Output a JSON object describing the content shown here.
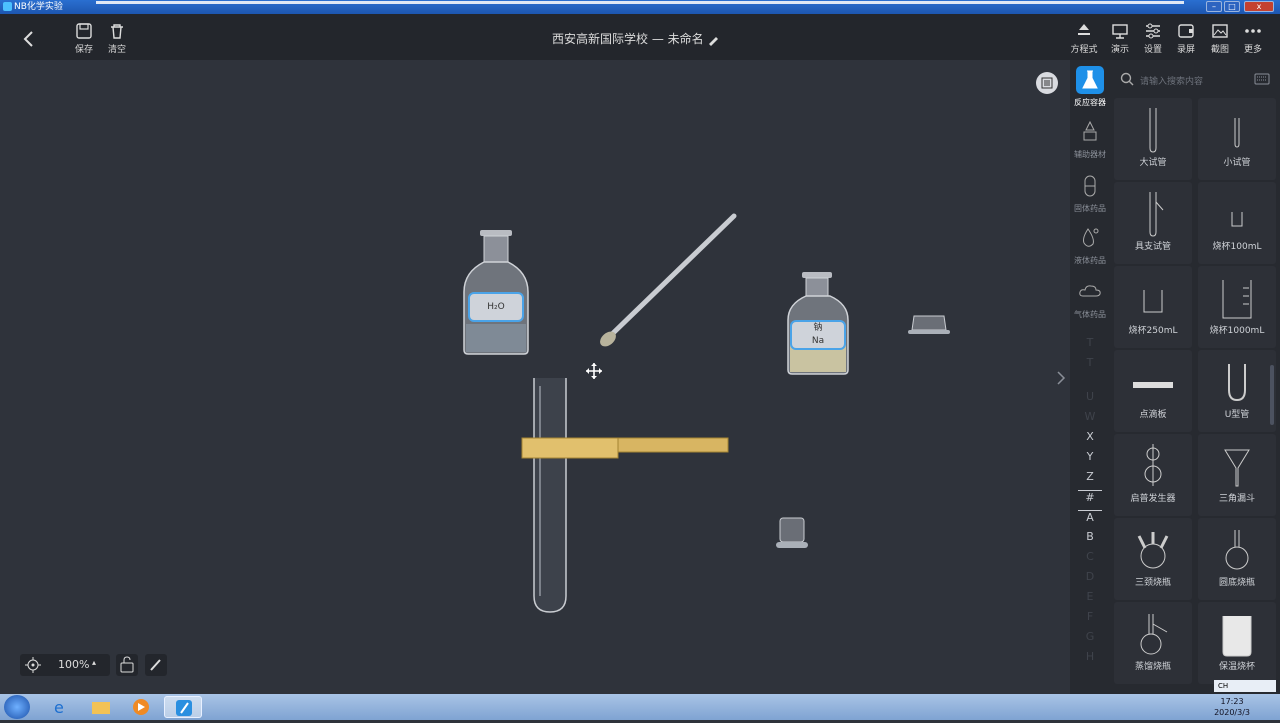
{
  "window": {
    "title": "NB化学实验"
  },
  "toolbar": {
    "save_label": "保存",
    "clear_label": "清空",
    "doc_title": "西安高新国际学校 — 未命名",
    "right_tools": [
      "方程式",
      "演示",
      "设置",
      "录屏",
      "截图",
      "更多"
    ]
  },
  "sidebar": {
    "categories": [
      "反应容器",
      "辅助器材",
      "固体药品",
      "液体药品",
      "气体药品"
    ],
    "letters": [
      "T",
      "U",
      "W",
      "X",
      "Y",
      "Z",
      "#",
      "A",
      "B",
      "C",
      "D",
      "E",
      "F",
      "G",
      "H"
    ],
    "search_placeholder": "请输入搜索内容",
    "items": [
      "大试管",
      "小试管",
      "具支试管",
      "烧杯100mL",
      "烧杯250mL",
      "烧杯1000mL",
      "点滴板",
      "U型管",
      "启普发生器",
      "三角漏斗",
      "三颈烧瓶",
      "圆底烧瓶",
      "蒸馏烧瓶",
      "保温烧杯"
    ]
  },
  "stage": {
    "bottle1_label": "H₂O",
    "bottle2_label_cn": "钠",
    "bottle2_label_en": "Na",
    "zoom": "100%"
  },
  "taskbar": {
    "time": "17:23",
    "date": "2020/3/3",
    "ime": "CH"
  }
}
